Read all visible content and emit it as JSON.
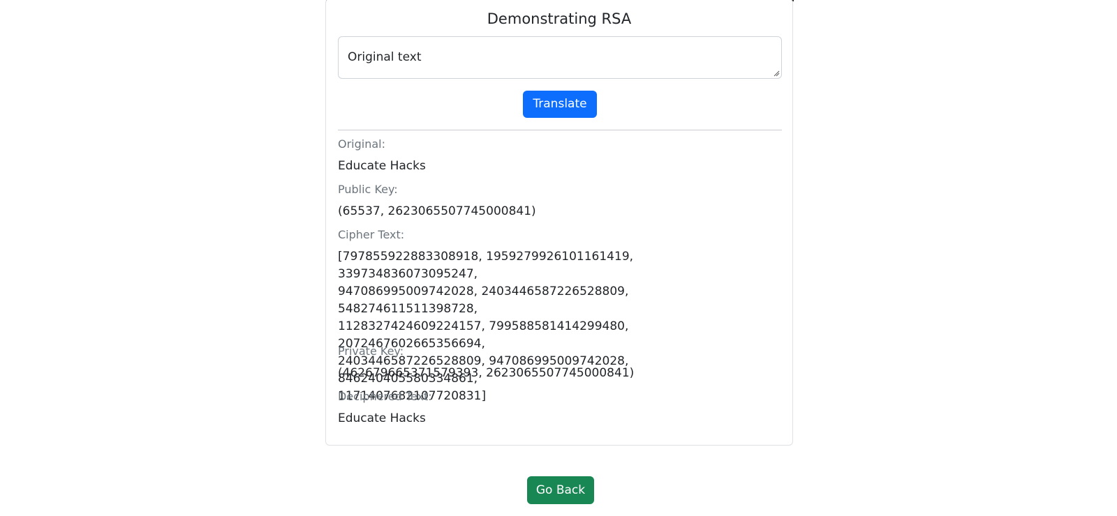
{
  "card": {
    "title": "Demonstrating RSA",
    "input": {
      "value": "Original text"
    },
    "translate_label": "Translate"
  },
  "results": {
    "original_label": "Original:",
    "original_value": "Educate Hacks",
    "public_key_label": "Public Key:",
    "public_key_value": "(65537, 2623065507745000841)",
    "cipher_label": "Cipher Text:",
    "cipher_lines": [
      "[797855922883308918, 1959279926101161419, 339734836073095247,",
      "947086995009742028, 2403446587226528809, 548274611511398728,",
      "1128327424609224157, 799588581414299480, 2072467602665356694,",
      "2403446587226528809, 947086995009742028, 846240405580334861,",
      "1171407682107720831]"
    ],
    "private_key_label": "Private Key:",
    "private_key_value": "(462679665371579393, 2623065507745000841)",
    "deciphered_label": "Deciphered Text:",
    "deciphered_value": "Educate Hacks"
  },
  "footer": {
    "back_label": "Go Back"
  },
  "colors": {
    "primary": "#0d6efd",
    "success": "#198754",
    "muted": "#6c757d",
    "text": "#212529"
  }
}
